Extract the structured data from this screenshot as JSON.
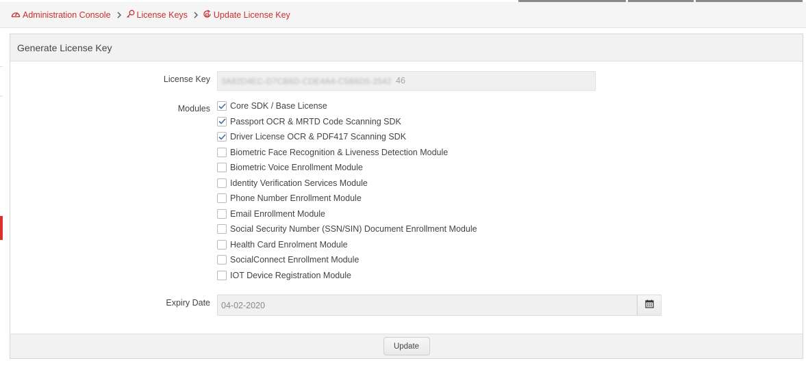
{
  "breadcrumb": {
    "items": [
      {
        "label": "Administration Console",
        "icon": "dashboard-icon"
      },
      {
        "label": "License Keys",
        "icon": "key-icon"
      },
      {
        "label": "Update License Key",
        "icon": "refresh-lock-icon"
      }
    ],
    "separator_icon": "chevron-right-icon",
    "color": "#c9302c"
  },
  "panel": {
    "title": "Generate License Key",
    "license_key": {
      "label": "License Key",
      "value_blurred": "3A82D4EC-D7CB6D-CDE4A4-C5B6D5-2542",
      "value_visible_tail": "46"
    },
    "modules": {
      "label": "Modules",
      "items": [
        {
          "label": "Core SDK / Base License",
          "checked": true
        },
        {
          "label": "Passport OCR & MRTD Code Scanning SDK",
          "checked": true
        },
        {
          "label": "Driver License OCR & PDF417 Scanning SDK",
          "checked": true
        },
        {
          "label": "Biometric Face Recognition & Liveness Detection Module",
          "checked": false
        },
        {
          "label": "Biometric Voice Enrollment Module",
          "checked": false
        },
        {
          "label": "Identity Verification Services Module",
          "checked": false
        },
        {
          "label": "Phone Number Enrollment Module",
          "checked": false
        },
        {
          "label": "Email Enrollment Module",
          "checked": false
        },
        {
          "label": "Social Security Number (SSN/SIN) Document Enrollment Module",
          "checked": false
        },
        {
          "label": "Health Card Enrolment Module",
          "checked": false
        },
        {
          "label": "SocialConnect Enrollment Module",
          "checked": false
        },
        {
          "label": "IOT Device Registration Module",
          "checked": false
        }
      ]
    },
    "expiry_date": {
      "label": "Expiry Date",
      "value": "04-02-2020",
      "icon": "calendar-icon"
    },
    "update_label": "Update"
  },
  "colors": {
    "accent_red": "#c9302c",
    "check_blue": "#3a6ea5",
    "panel_header_bg": "#f2f2f2",
    "input_bg": "#f0f0f0"
  }
}
